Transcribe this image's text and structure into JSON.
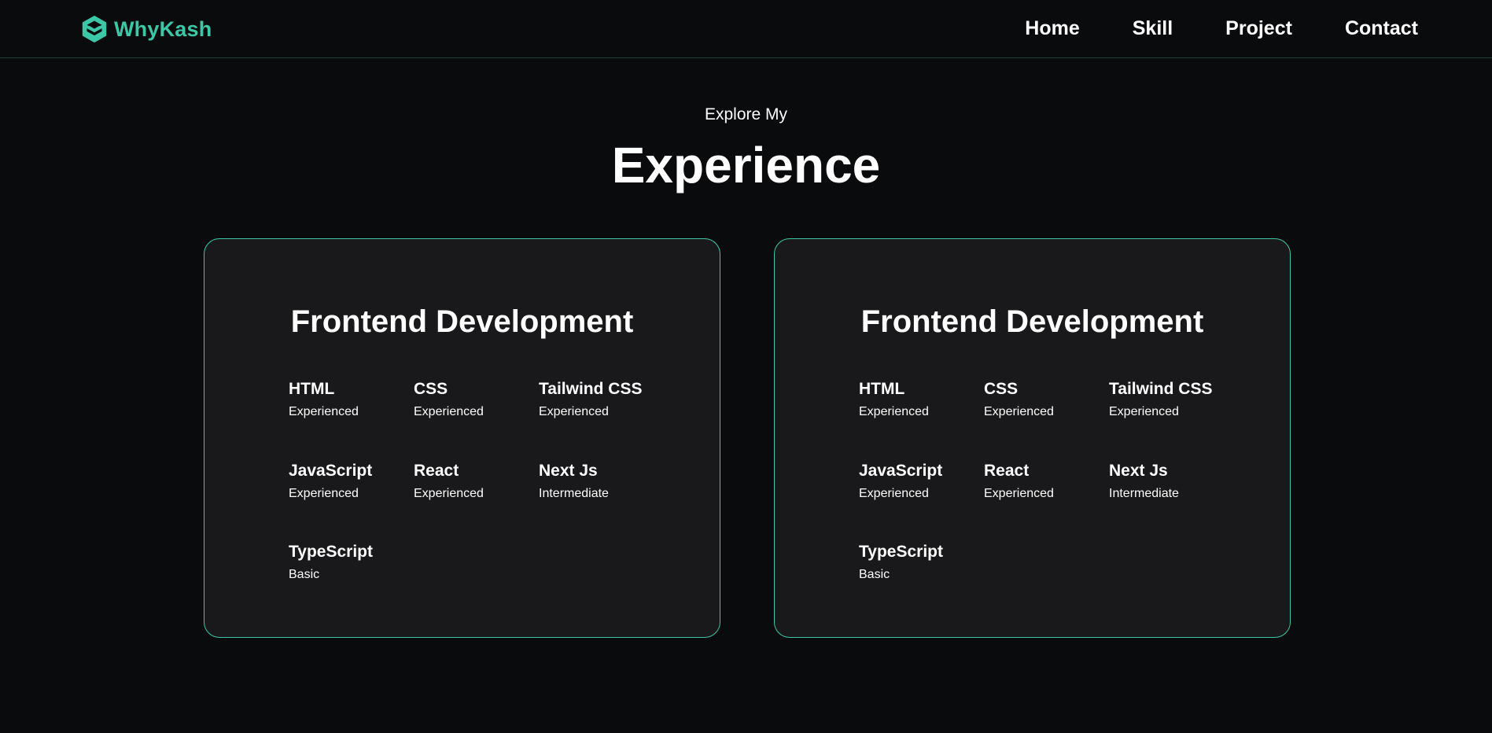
{
  "brand": {
    "name": "WhyKash",
    "icon": "hexagon-stack-logo-icon",
    "accent_color": "#3cc7a7"
  },
  "nav": {
    "items": [
      {
        "label": "Home"
      },
      {
        "label": "Skill"
      },
      {
        "label": "Project"
      },
      {
        "label": "Contact"
      }
    ]
  },
  "hero": {
    "eyebrow": "Explore My",
    "title": "Experience"
  },
  "cards": [
    {
      "title": "Frontend Development",
      "skills": [
        {
          "name": "HTML",
          "level": "Experienced"
        },
        {
          "name": "CSS",
          "level": "Experienced"
        },
        {
          "name": "Tailwind CSS",
          "level": "Experienced"
        },
        {
          "name": "JavaScript",
          "level": "Experienced"
        },
        {
          "name": "React",
          "level": "Experienced"
        },
        {
          "name": "Next Js",
          "level": "Intermediate"
        },
        {
          "name": "TypeScript",
          "level": "Basic"
        }
      ]
    },
    {
      "title": "Frontend Development",
      "skills": [
        {
          "name": "HTML",
          "level": "Experienced"
        },
        {
          "name": "CSS",
          "level": "Experienced"
        },
        {
          "name": "Tailwind CSS",
          "level": "Experienced"
        },
        {
          "name": "JavaScript",
          "level": "Experienced"
        },
        {
          "name": "React",
          "level": "Experienced"
        },
        {
          "name": "Next Js",
          "level": "Intermediate"
        },
        {
          "name": "TypeScript",
          "level": "Basic"
        }
      ]
    }
  ]
}
